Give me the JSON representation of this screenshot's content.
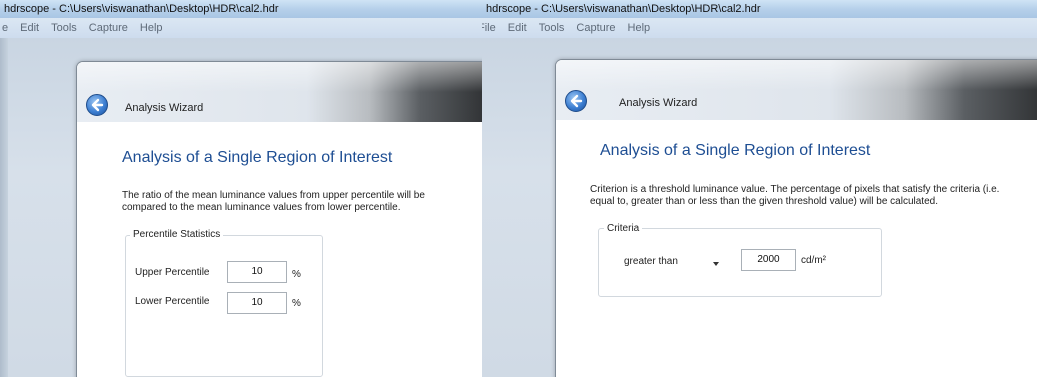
{
  "left": {
    "window_title": "hdrscope - C:\\Users\\viswanathan\\Desktop\\HDR\\cal2.hdr",
    "menu": [
      "e",
      "Edit",
      "Tools",
      "Capture",
      "Help"
    ],
    "wizard": {
      "title": "Analysis Wizard",
      "heading": "Analysis of a Single Region of Interest",
      "description": "The ratio of the mean luminance values from upper percentile will be compared to the mean luminance values from lower percentile.",
      "group_label": "Percentile Statistics",
      "upper": {
        "label": "Upper Percentile",
        "value": "10",
        "unit": "%"
      },
      "lower": {
        "label": "Lower Percentile",
        "value": "10",
        "unit": "%"
      }
    }
  },
  "right": {
    "window_title": "hdrscope - C:\\Users\\viswanathan\\Desktop\\HDR\\cal2.hdr",
    "menu": [
      "File",
      "Edit",
      "Tools",
      "Capture",
      "Help"
    ],
    "wizard": {
      "title": "Analysis Wizard",
      "heading": "Analysis of a Single Region of Interest",
      "description": "Criterion is a threshold luminance value. The percentage of pixels that satisfy the criteria (i.e. equal to, greater than or less than the given threshold value) will be calculated.",
      "group_label": "Criteria",
      "criteria_selected": "greater than",
      "threshold_value": "2000",
      "threshold_unit": "cd/m²"
    }
  },
  "colors": {
    "heading": "#1e4e93",
    "titlebar": "#b6d0ea",
    "back_button": "#3d7fd2"
  }
}
